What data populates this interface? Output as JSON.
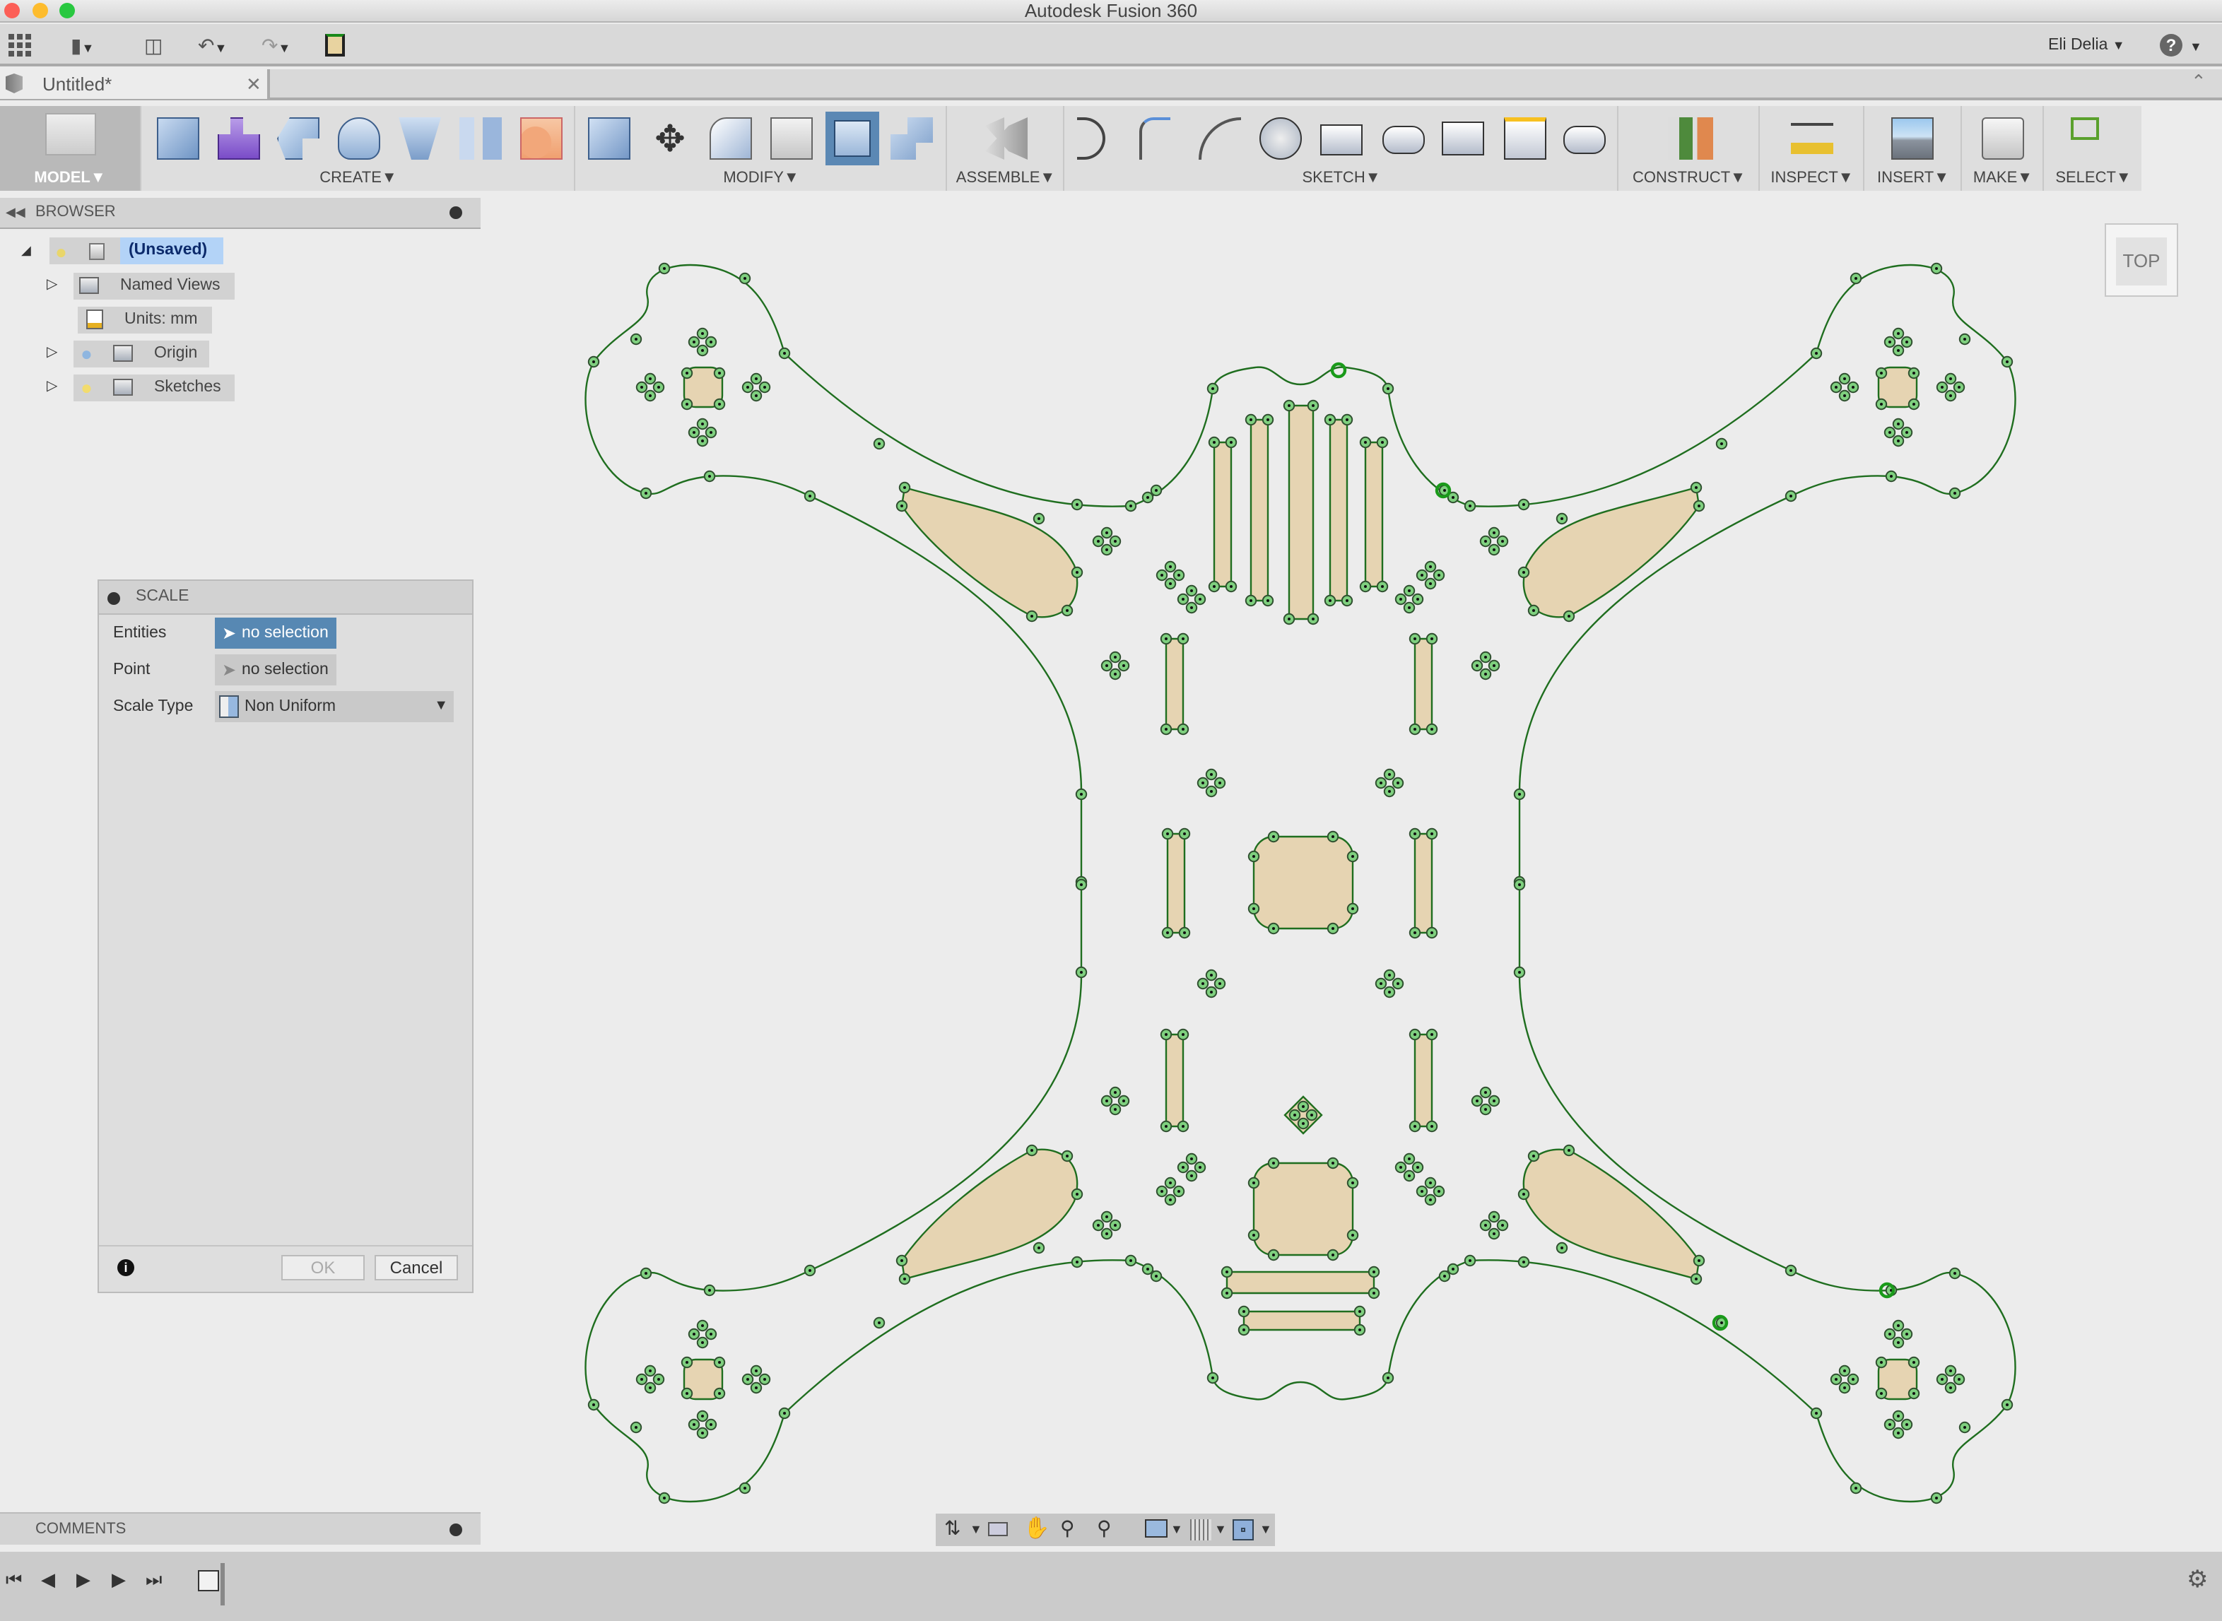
{
  "window": {
    "title": "Autodesk Fusion 360"
  },
  "quick_access": {
    "user": "Eli Delia",
    "help": "?"
  },
  "document_tab": {
    "title": "Untitled*"
  },
  "toolbar": {
    "groups": [
      {
        "label": "MODEL"
      },
      {
        "label": "CREATE"
      },
      {
        "label": "MODIFY"
      },
      {
        "label": "ASSEMBLE"
      },
      {
        "label": "SKETCH"
      },
      {
        "label": "CONSTRUCT"
      },
      {
        "label": "INSPECT"
      },
      {
        "label": "INSERT"
      },
      {
        "label": "MAKE"
      },
      {
        "label": "SELECT"
      }
    ]
  },
  "browser": {
    "title": "BROWSER",
    "items": [
      {
        "label": "(Unsaved)"
      },
      {
        "label": "Named Views"
      },
      {
        "label": "Units: mm"
      },
      {
        "label": "Origin"
      },
      {
        "label": "Sketches"
      }
    ]
  },
  "scale_dialog": {
    "title": "SCALE",
    "entities_label": "Entities",
    "entities_value": "no selection",
    "point_label": "Point",
    "point_value": "no selection",
    "scale_type_label": "Scale Type",
    "scale_type_value": "Non Uniform",
    "ok": "OK",
    "cancel": "Cancel",
    "info": "i"
  },
  "comments": {
    "title": "COMMENTS"
  },
  "viewcube": {
    "face": "TOP"
  },
  "colors": {
    "sketch_line": "#1f6e1f",
    "profile_fill": "#e6d4b2",
    "point_fill": "#7fd07f",
    "selection_blue": "#5788b3"
  }
}
